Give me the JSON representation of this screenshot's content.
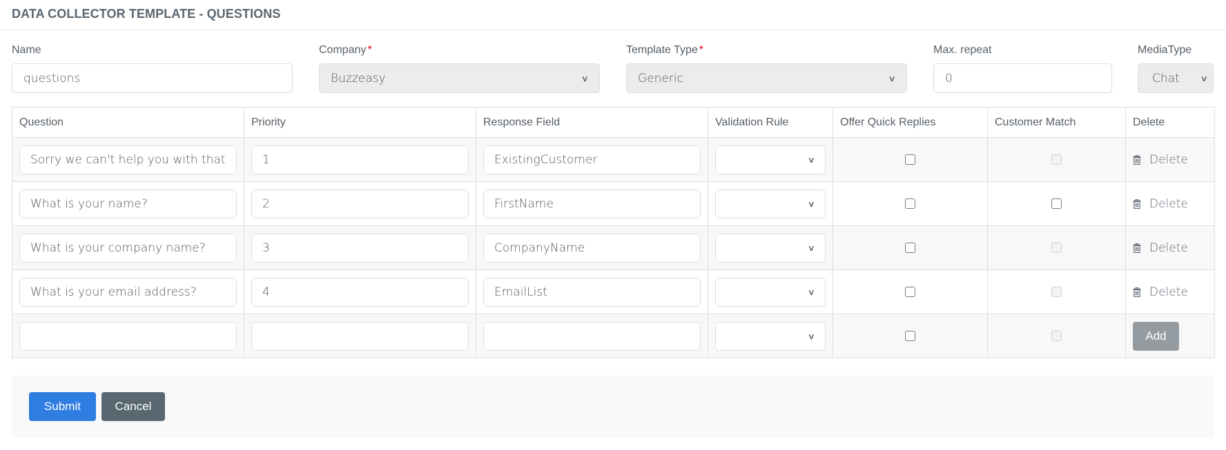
{
  "header": {
    "title": "DATA COLLECTOR TEMPLATE - QUESTIONS"
  },
  "form": {
    "name": {
      "label": "Name",
      "value": "questions"
    },
    "company": {
      "label": "Company",
      "required_mark": "*",
      "value": "Buzzeasy"
    },
    "template_type": {
      "label": "Template Type",
      "required_mark": "*",
      "value": "Generic"
    },
    "max_repeat": {
      "label": "Max. repeat",
      "value": "0"
    },
    "media_type": {
      "label": "MediaType",
      "value": "Chat"
    }
  },
  "table": {
    "columns": [
      "Question",
      "Priority",
      "Response Field",
      "Validation Rule",
      "Offer Quick Replies",
      "Customer Match",
      "Delete"
    ],
    "rows": [
      {
        "question": "Sorry we can't help you with that",
        "priority": "1",
        "response_field": "ExistingCustomer",
        "validation_rule": "",
        "offer_quick_replies": false,
        "customer_match": false,
        "customer_match_enabled": false,
        "action": "Delete"
      },
      {
        "question": "What is your name?",
        "priority": "2",
        "response_field": "FirstName",
        "validation_rule": "",
        "offer_quick_replies": false,
        "customer_match": false,
        "customer_match_enabled": true,
        "action": "Delete"
      },
      {
        "question": "What is your company name?",
        "priority": "3",
        "response_field": "CompanyName",
        "validation_rule": "",
        "offer_quick_replies": false,
        "customer_match": false,
        "customer_match_enabled": false,
        "action": "Delete"
      },
      {
        "question": "What is your email address?",
        "priority": "4",
        "response_field": "EmailList",
        "validation_rule": "",
        "offer_quick_replies": false,
        "customer_match": false,
        "customer_match_enabled": false,
        "action": "Delete"
      }
    ],
    "new_row": {
      "question": "",
      "priority": "",
      "response_field": "",
      "validation_rule": "",
      "add_label": "Add"
    }
  },
  "footer": {
    "submit_label": "Submit",
    "cancel_label": "Cancel"
  },
  "colors": {
    "primary": "#2f7de1",
    "secondary": "#586770",
    "add_button": "#959ca1",
    "required": "#e0000a"
  }
}
